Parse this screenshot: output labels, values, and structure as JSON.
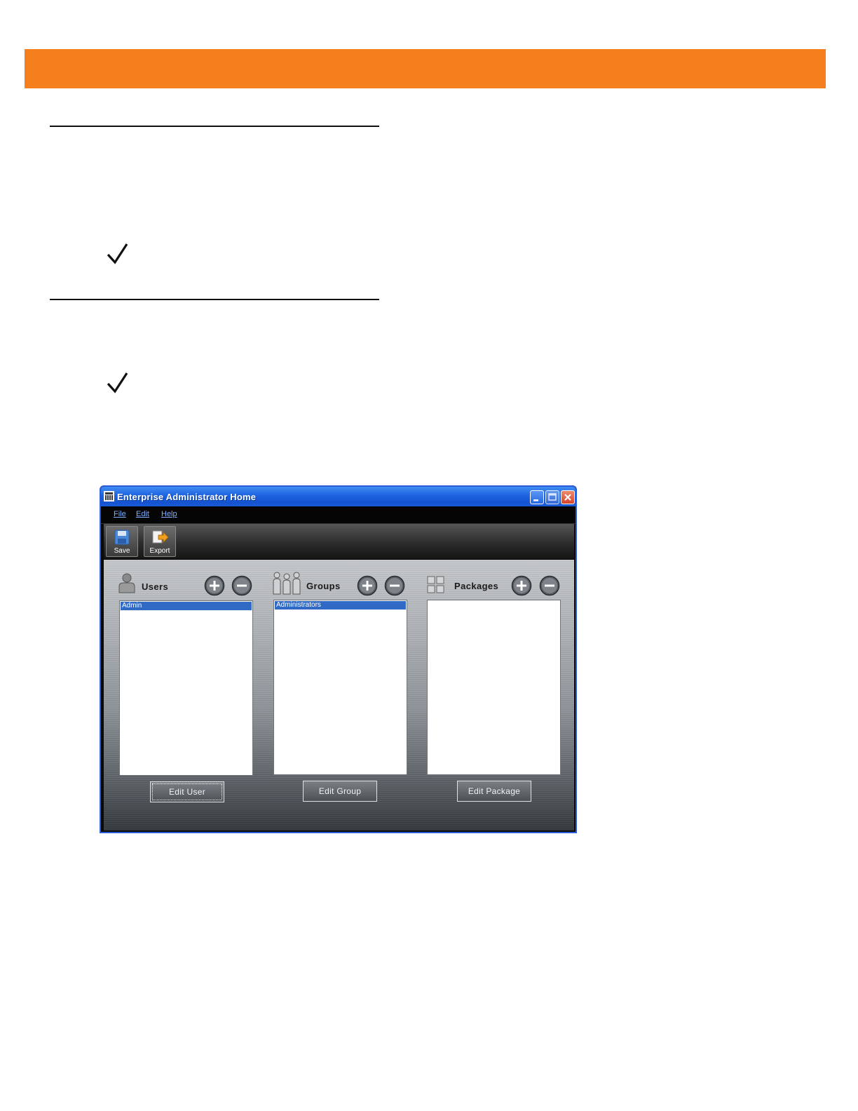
{
  "window": {
    "title": "Enterprise Administrator Home",
    "menu": [
      "File",
      "Edit",
      "Help"
    ],
    "toolbar": {
      "save_label": "Save",
      "export_label": "Export"
    }
  },
  "sections": {
    "users": {
      "title": "Users",
      "items": [
        "Admin"
      ],
      "edit_label": "Edit User"
    },
    "groups": {
      "title": "Groups",
      "items": [
        "Administrators"
      ],
      "edit_label": "Edit Group"
    },
    "packages": {
      "title": "Packages",
      "items": [],
      "edit_label": "Edit Package"
    }
  },
  "colors": {
    "banner": "#f47f1c",
    "titlebar": "#1d62e0",
    "selection": "#316ac5",
    "menu_text": "#7fb0ff"
  },
  "icons": {
    "note_marks": [
      "checkmark-icon",
      "checkmark-icon"
    ],
    "users": "user-icon",
    "groups": "group-icon",
    "packages": "packages-grid-icon"
  }
}
